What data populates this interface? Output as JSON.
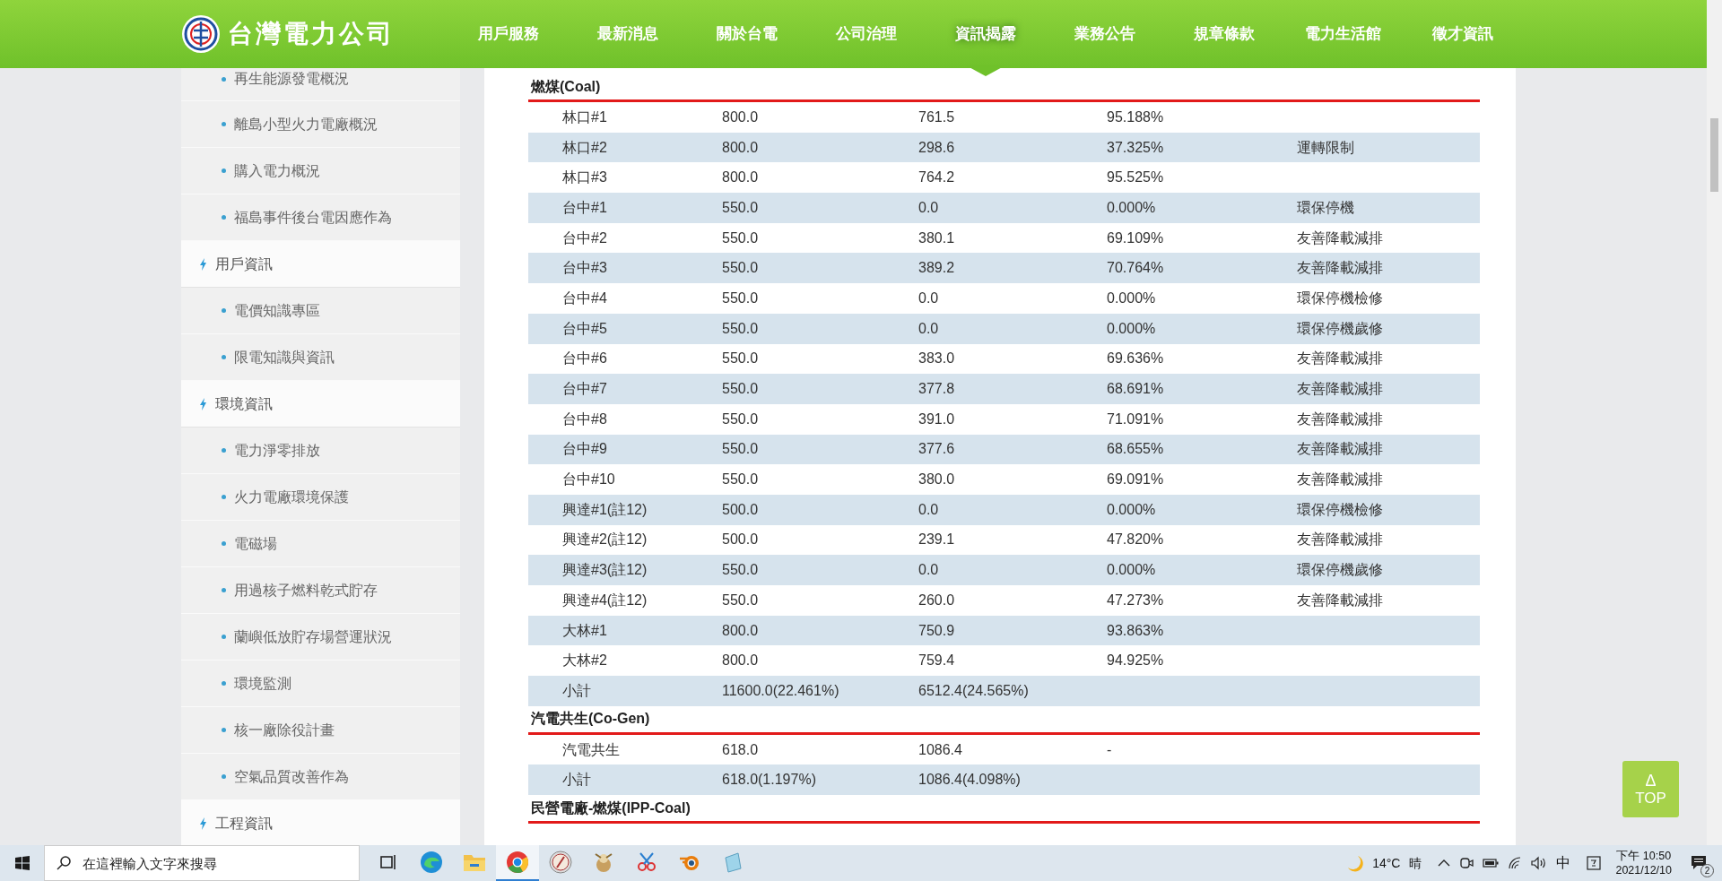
{
  "header": {
    "logo_text": "台灣電力公司",
    "nav": [
      {
        "label": "用戶服務",
        "selected": false
      },
      {
        "label": "最新消息",
        "selected": false
      },
      {
        "label": "關於台電",
        "selected": false
      },
      {
        "label": "公司治理",
        "selected": false
      },
      {
        "label": "資訊揭露",
        "selected": true
      },
      {
        "label": "業務公告",
        "selected": false
      },
      {
        "label": "規章條款",
        "selected": false
      },
      {
        "label": "電力生活館",
        "selected": false
      },
      {
        "label": "徵才資訊",
        "selected": false
      }
    ]
  },
  "sidebar": {
    "groups": [
      {
        "items": [
          "再生能源發電概況",
          "離島小型火力電廠概況",
          "購入電力概況",
          "福島事件後台電因應作為"
        ]
      },
      {
        "title": "用戶資訊",
        "items": [
          "電價知識專區",
          "限電知識與資訊"
        ]
      },
      {
        "title": "環境資訊",
        "items": [
          "電力淨零排放",
          "火力電廠環境保護",
          "電磁場",
          "用過核子燃料乾式貯存",
          "蘭嶼低放貯存場營運狀況",
          "環境監測",
          "核一廠除役計畫",
          "空氣品質改善作為"
        ]
      },
      {
        "title": "工程資訊"
      }
    ]
  },
  "sections": [
    {
      "title": "燃煤(Coal)",
      "rows": [
        {
          "unit": "林口#1",
          "capacity": "800.0",
          "output": "761.5",
          "ratio": "95.188%"
        },
        {
          "unit": "林口#2",
          "capacity": "800.0",
          "output": "298.6",
          "ratio": "37.325%",
          "note": "運轉限制"
        },
        {
          "unit": "林口#3",
          "capacity": "800.0",
          "output": "764.2",
          "ratio": "95.525%"
        },
        {
          "unit": "台中#1",
          "capacity": "550.0",
          "output": "0.0",
          "ratio": "0.000%",
          "note": "環保停機"
        },
        {
          "unit": "台中#2",
          "capacity": "550.0",
          "output": "380.1",
          "ratio": "69.109%",
          "note": "友善降載減排"
        },
        {
          "unit": "台中#3",
          "capacity": "550.0",
          "output": "389.2",
          "ratio": "70.764%",
          "note": "友善降載減排"
        },
        {
          "unit": "台中#4",
          "capacity": "550.0",
          "output": "0.0",
          "ratio": "0.000%",
          "note": "環保停機檢修"
        },
        {
          "unit": "台中#5",
          "capacity": "550.0",
          "output": "0.0",
          "ratio": "0.000%",
          "note": "環保停機歲修"
        },
        {
          "unit": "台中#6",
          "capacity": "550.0",
          "output": "383.0",
          "ratio": "69.636%",
          "note": "友善降載減排"
        },
        {
          "unit": "台中#7",
          "capacity": "550.0",
          "output": "377.8",
          "ratio": "68.691%",
          "note": "友善降載減排"
        },
        {
          "unit": "台中#8",
          "capacity": "550.0",
          "output": "391.0",
          "ratio": "71.091%",
          "note": "友善降載減排"
        },
        {
          "unit": "台中#9",
          "capacity": "550.0",
          "output": "377.6",
          "ratio": "68.655%",
          "note": "友善降載減排"
        },
        {
          "unit": "台中#10",
          "capacity": "550.0",
          "output": "380.0",
          "ratio": "69.091%",
          "note": "友善降載減排"
        },
        {
          "unit": "興達#1(註12)",
          "capacity": "500.0",
          "output": "0.0",
          "ratio": "0.000%",
          "note": "環保停機檢修"
        },
        {
          "unit": "興達#2(註12)",
          "capacity": "500.0",
          "output": "239.1",
          "ratio": "47.820%",
          "note": "友善降載減排"
        },
        {
          "unit": "興達#3(註12)",
          "capacity": "550.0",
          "output": "0.0",
          "ratio": "0.000%",
          "note": "環保停機歲修"
        },
        {
          "unit": "興達#4(註12)",
          "capacity": "550.0",
          "output": "260.0",
          "ratio": "47.273%",
          "note": "友善降載減排"
        },
        {
          "unit": "大林#1",
          "capacity": "800.0",
          "output": "750.9",
          "ratio": "93.863%"
        },
        {
          "unit": "大林#2",
          "capacity": "800.0",
          "output": "759.4",
          "ratio": "94.925%"
        },
        {
          "unit": "小計",
          "capacity": "11600.0(22.461%)",
          "output": "6512.4(24.565%)"
        }
      ]
    },
    {
      "title": "汽電共生(Co-Gen)",
      "rows": [
        {
          "unit": "汽電共生",
          "capacity": "618.0",
          "output": "1086.4",
          "ratio": "-"
        },
        {
          "unit": "小計",
          "capacity": "618.0(1.197%)",
          "output": "1086.4(4.098%)"
        }
      ]
    },
    {
      "title": "民營電廠-燃煤(IPP-Coal)"
    }
  ],
  "top_button": {
    "arrow": "Δ",
    "label": "TOP"
  },
  "taskbar": {
    "search": {
      "placeholder": "在這裡輸入文字來搜尋"
    },
    "apps": [
      {
        "selected": false
      },
      {
        "selected": false
      },
      {
        "selected": false
      },
      {
        "selected": true
      },
      {
        "selected": false
      },
      {
        "selected": false
      },
      {
        "selected": false
      },
      {
        "selected": false
      },
      {
        "selected": false
      }
    ],
    "temperature": "14°C",
    "weather": "晴",
    "ime": "中",
    "time": "下午 10:50",
    "date": "2021/12/10",
    "notifications": "2"
  }
}
